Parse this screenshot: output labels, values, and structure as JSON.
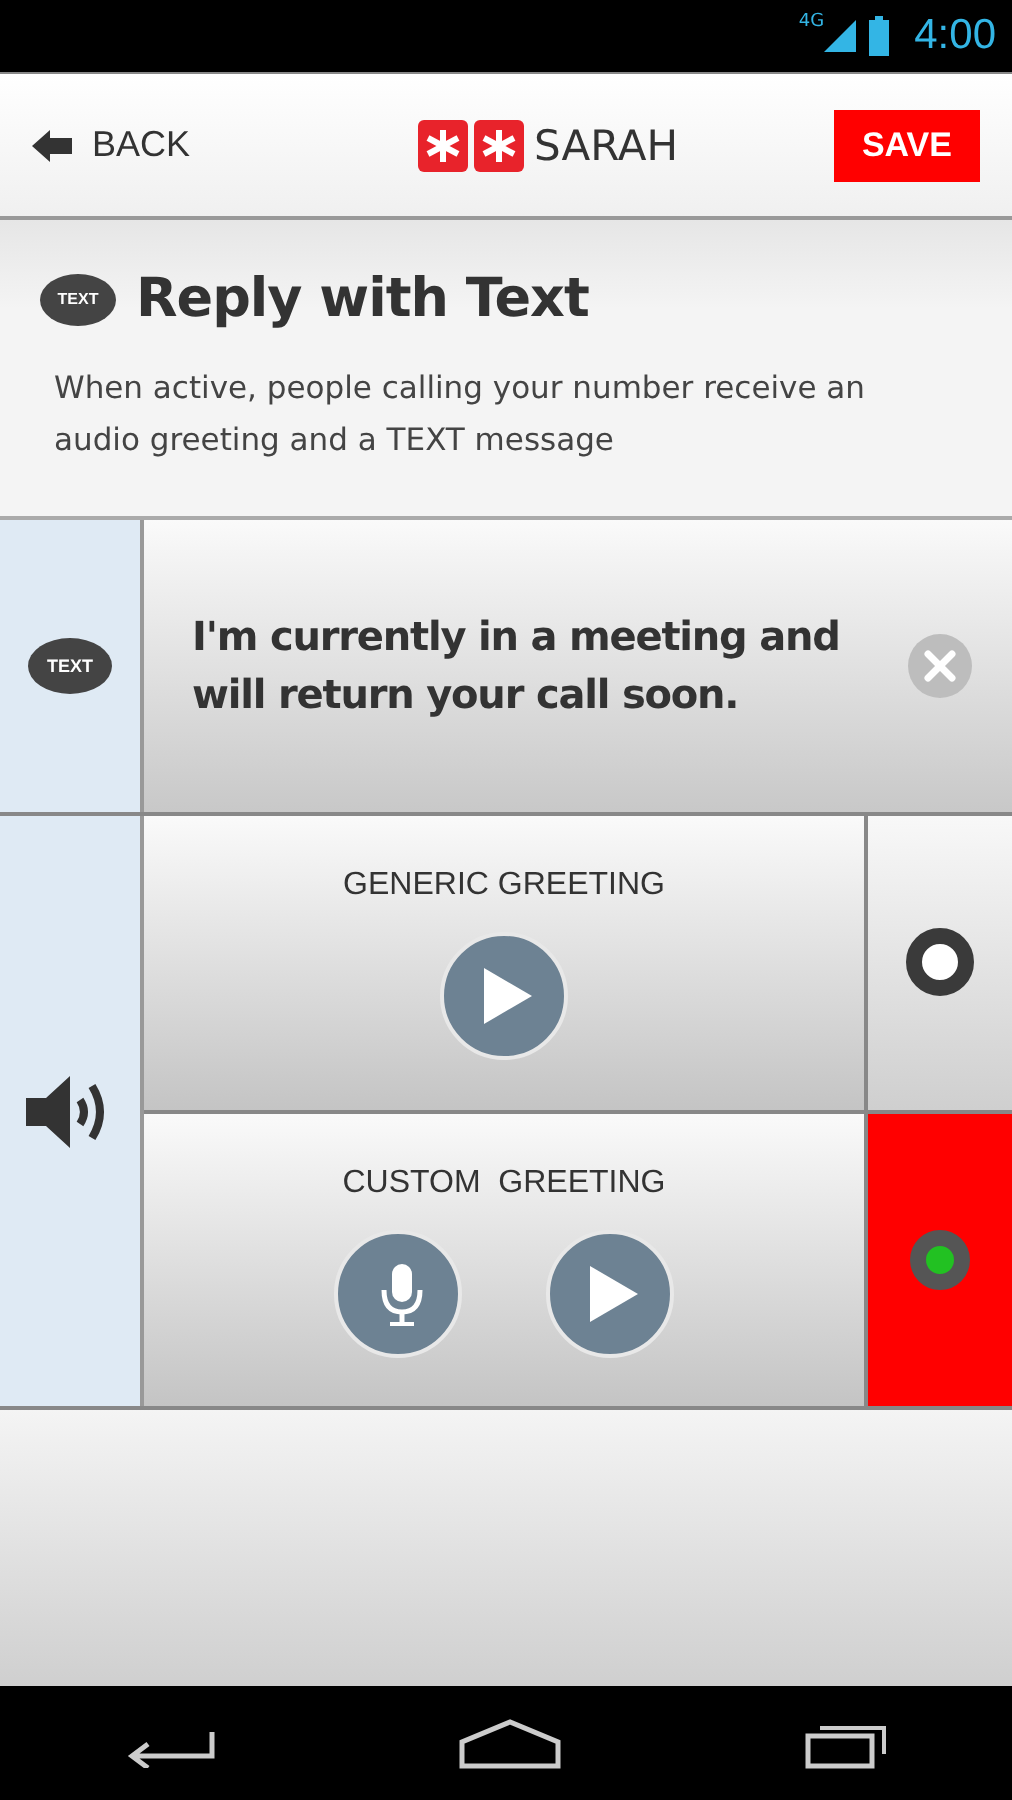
{
  "status_bar": {
    "network": "4G",
    "time": "4:00"
  },
  "header": {
    "back": "BACK",
    "brand": "SARAH",
    "save": "SAVE"
  },
  "intro": {
    "icon_label": "TEXT",
    "title": "Reply with Text",
    "description": "When active, people calling your number receive an audio greeting and a TEXT message"
  },
  "message": {
    "icon_label": "TEXT",
    "text": "I'm currently in a meeting and will return your call soon."
  },
  "greetings": [
    {
      "kind": "generic",
      "label": "GENERIC GREETING",
      "selected": false
    },
    {
      "kind": "custom",
      "label": "CUSTOM  GREETING",
      "selected": true
    }
  ]
}
